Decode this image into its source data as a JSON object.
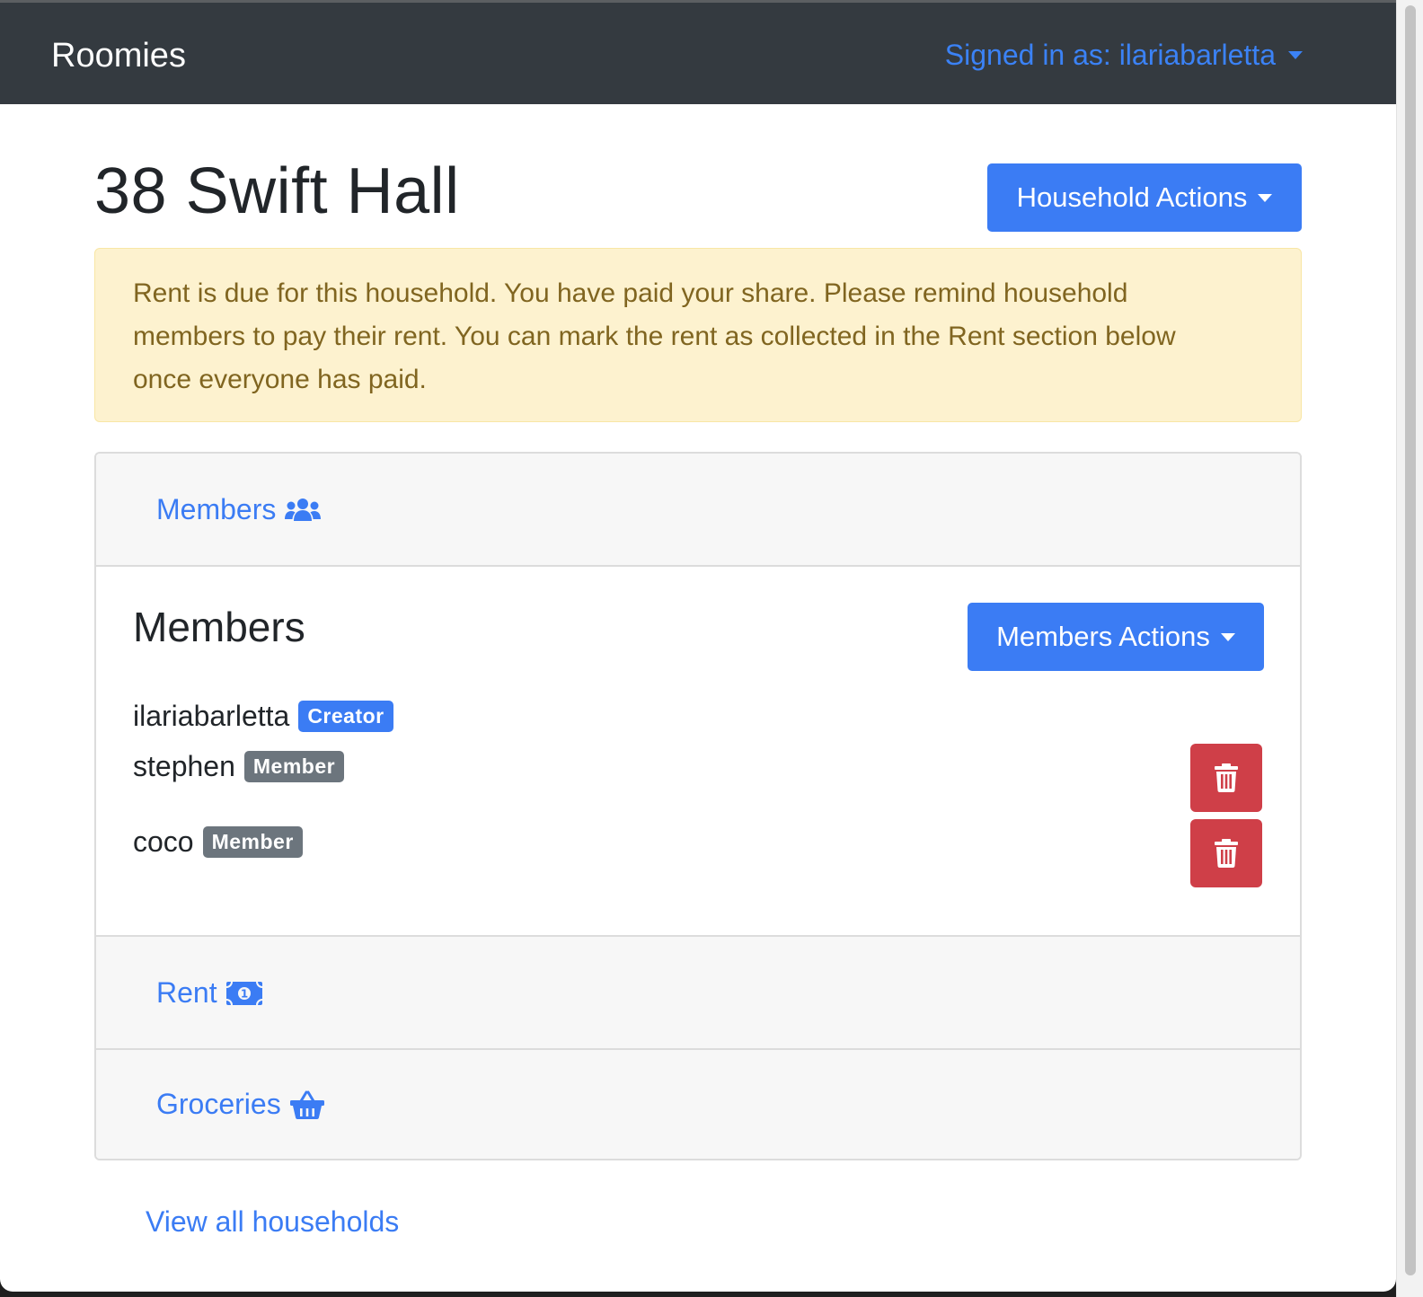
{
  "navbar": {
    "brand": "Roomies",
    "signed_in_label": "Signed in as: ilariabarletta"
  },
  "household": {
    "title": "38 Swift Hall",
    "actions_label": "Household Actions"
  },
  "alert": {
    "message": "Rent is due for this household. You have paid your share. Please remind household members to pay their rent. You can mark the rent as collected in the Rent section below once everyone has paid."
  },
  "accordion": {
    "members_header": "Members",
    "members_icon": "users-icon",
    "members_heading": "Members",
    "members_actions_label": "Members Actions",
    "members": [
      {
        "name": "ilariabarletta",
        "role": "Creator"
      },
      {
        "name": "stephen",
        "role": "Member"
      },
      {
        "name": "coco",
        "role": "Member"
      }
    ],
    "rent_header": "Rent",
    "rent_icon": "money-bill-icon",
    "groceries_header": "Groceries",
    "groceries_icon": "shopping-basket-icon"
  },
  "footer": {
    "view_all_label": "View all households"
  },
  "colors": {
    "navbar": "#343a40",
    "primary": "#3b7cf4",
    "danger": "#cf3f48",
    "warning_bg": "#fdf2cf",
    "warning_text": "#806520",
    "secondary_badge": "#6c757d"
  }
}
